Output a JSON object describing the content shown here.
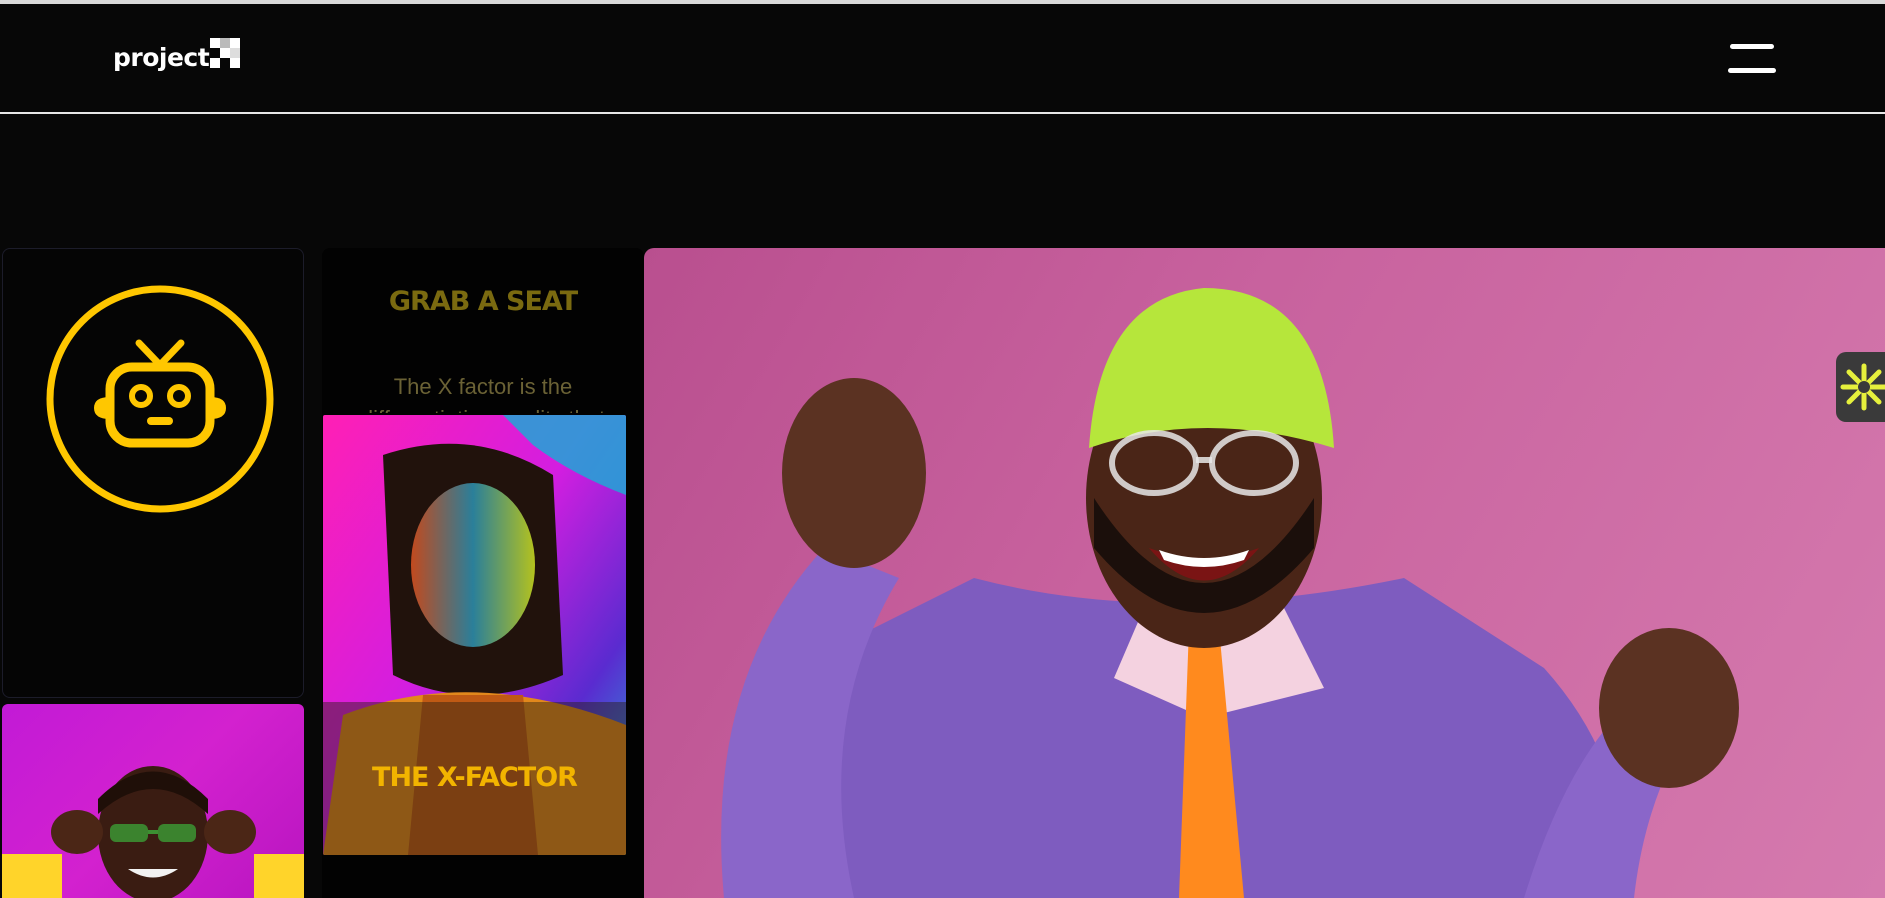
{
  "header": {
    "logo_text": "project",
    "logo_mark_icon": "checkered-x-logo",
    "menu_icon": "hamburger-menu-icon"
  },
  "cards": {
    "robot_icon": "robot-icon",
    "grab_a_seat": {
      "title": "GRAB A SEAT",
      "body": "The X factor is the differentiating quality that"
    },
    "x_factor": {
      "caption": "THE X-FACTOR"
    }
  },
  "side_badge": {
    "icon": "sparkle-icon"
  },
  "colors": {
    "background": "#070707",
    "accent_yellow": "#FFC700",
    "hero_pink": "#C8629E",
    "badge_bg": "#3A3A3A",
    "badge_icon": "#E6F03C"
  }
}
